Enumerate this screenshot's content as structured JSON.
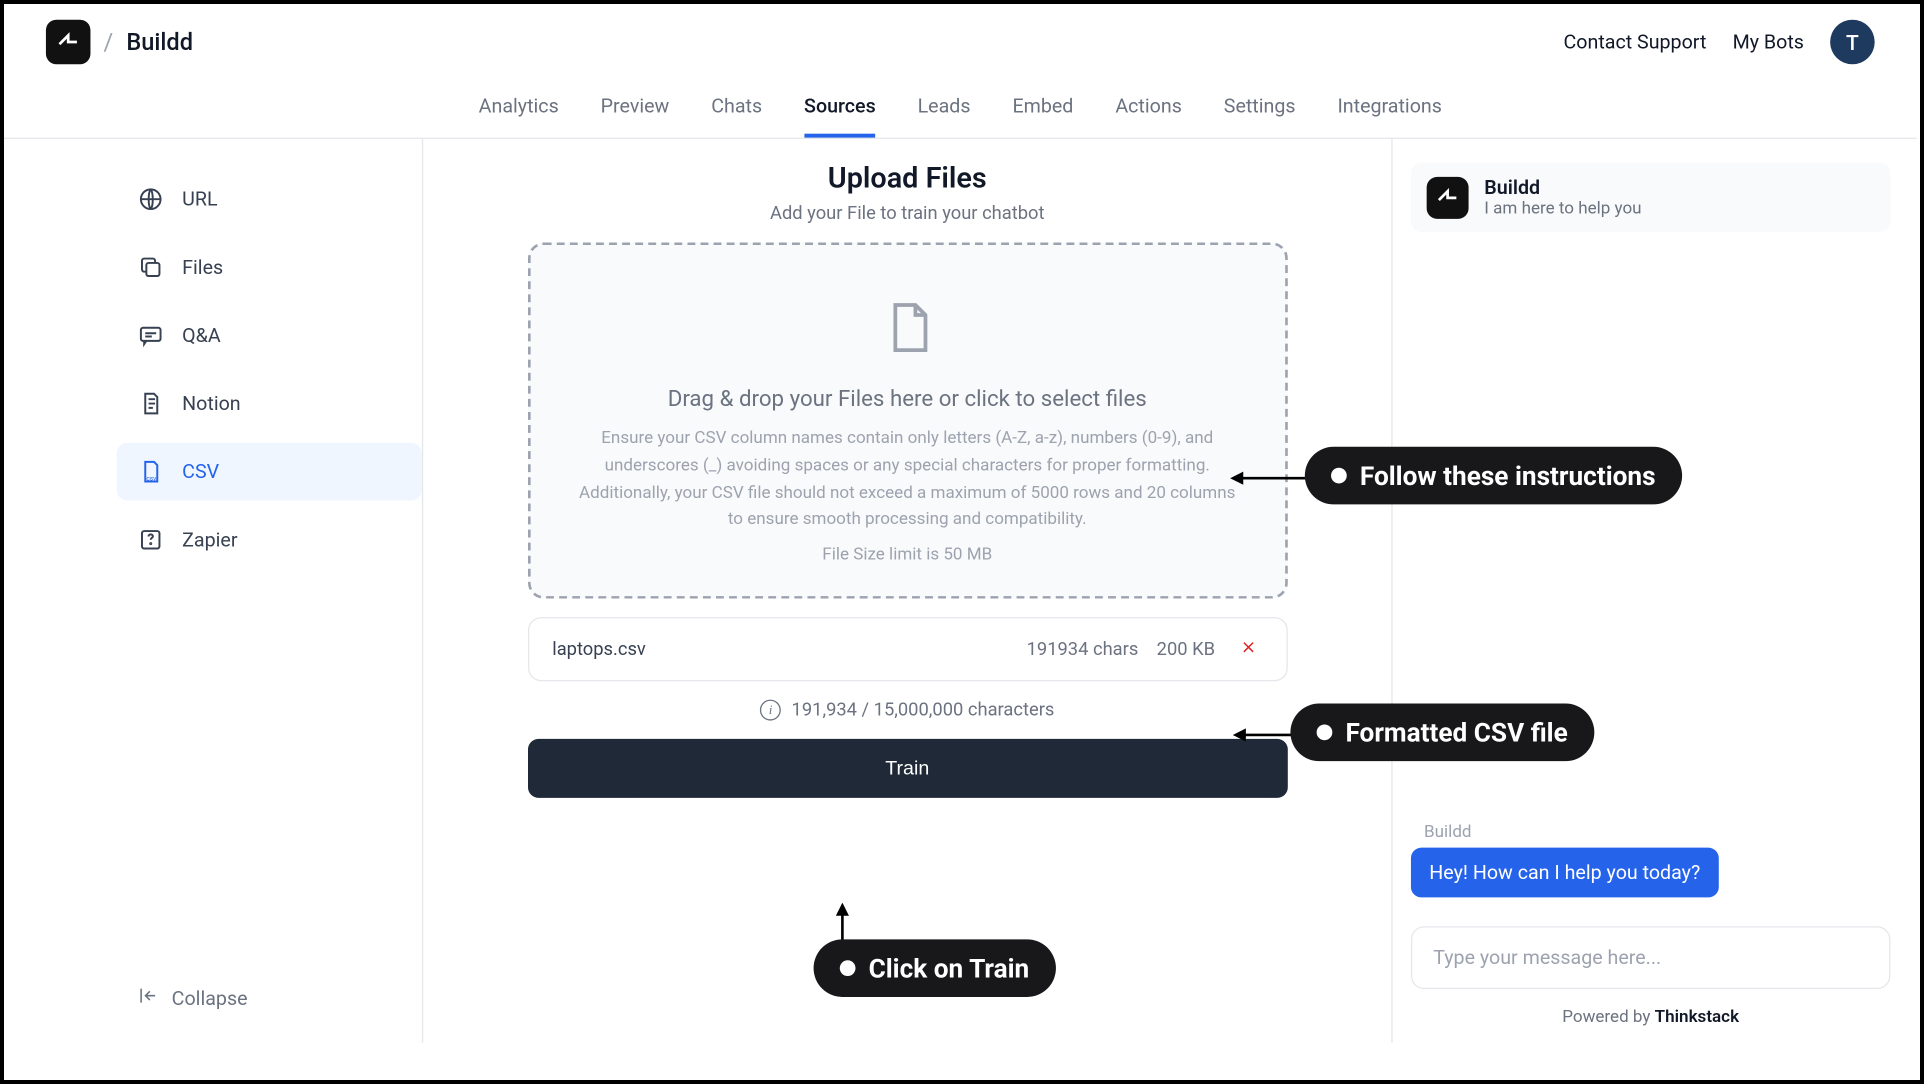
{
  "header": {
    "breadcrumb": "Buildd",
    "contact_support": "Contact Support",
    "my_bots": "My Bots",
    "avatar_letter": "T"
  },
  "tabs": [
    {
      "label": "Analytics",
      "active": false
    },
    {
      "label": "Preview",
      "active": false
    },
    {
      "label": "Chats",
      "active": false
    },
    {
      "label": "Sources",
      "active": true
    },
    {
      "label": "Leads",
      "active": false
    },
    {
      "label": "Embed",
      "active": false
    },
    {
      "label": "Actions",
      "active": false
    },
    {
      "label": "Settings",
      "active": false
    },
    {
      "label": "Integrations",
      "active": false
    }
  ],
  "sidebar": {
    "items": [
      {
        "label": "URL",
        "icon": "globe-icon"
      },
      {
        "label": "Files",
        "icon": "copy-icon"
      },
      {
        "label": "Q&A",
        "icon": "chat-icon"
      },
      {
        "label": "Notion",
        "icon": "notion-icon"
      },
      {
        "label": "CSV",
        "icon": "csv-icon"
      },
      {
        "label": "Zapier",
        "icon": "zapier-icon"
      }
    ],
    "active_index": 4,
    "collapse_label": "Collapse"
  },
  "main": {
    "title": "Upload Files",
    "subtitle": "Add your File to train your chatbot",
    "drop_title": "Drag & drop your Files here or click to select files",
    "drop_desc": "Ensure your CSV column names contain only letters (A-Z, a-z), numbers (0-9), and underscores (_) avoiding spaces or any special characters for proper formatting. Additionally, your CSV file should not exceed a maximum of 5000 rows and 20 columns to ensure smooth processing and compatibility.",
    "drop_limit": "File Size limit is 50 MB",
    "file": {
      "name": "laptops.csv",
      "chars": "191934 chars",
      "size": "200 KB"
    },
    "char_count": "191,934 / 15,000,000 characters",
    "train_label": "Train"
  },
  "chat": {
    "title": "Buildd",
    "subtitle": "I am here to help you",
    "bot_name": "Buildd",
    "bot_msg": "Hey! How can I help you today?",
    "input_placeholder": "Type your message here...",
    "powered_prefix": "Powered by ",
    "powered_brand": "Thinkstack"
  },
  "callouts": {
    "instructions": "Follow these instructions",
    "csv": "Formatted CSV file",
    "train": "Click on Train"
  }
}
